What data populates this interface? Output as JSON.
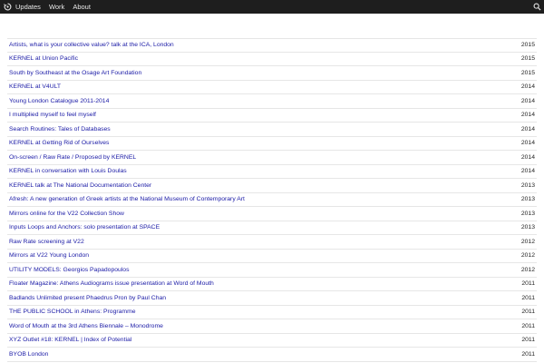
{
  "nav": {
    "logo_icon": "circular-arrows-icon",
    "items": [
      "Updates",
      "Work",
      "About"
    ],
    "search_icon": "search-icon"
  },
  "entries": [
    {
      "title": "Artists, what is your collective value? talk at the ICA, London",
      "year": "2015"
    },
    {
      "title": "KERNEL at Union Pacific",
      "year": "2015"
    },
    {
      "title": "South by Southeast at the Osage Art Foundation",
      "year": "2015"
    },
    {
      "title": "KERNEL at V4ULT",
      "year": "2014"
    },
    {
      "title": "Young London Catalogue 2011-2014",
      "year": "2014"
    },
    {
      "title": "I multiplied myself to feel myself",
      "year": "2014"
    },
    {
      "title": "Search Routines: Tales of Databases",
      "year": "2014"
    },
    {
      "title": "KERNEL at Getting Rid of Ourselves",
      "year": "2014"
    },
    {
      "title": "On-screen / Raw Rate / Proposed by KERNEL",
      "year": "2014"
    },
    {
      "title": "KERNEL in conversation with Louis Doulas",
      "year": "2014"
    },
    {
      "title": "KERNEL talk at The National Documentation Center",
      "year": "2013"
    },
    {
      "title": "Afresh: A new generation of Greek artists at the National Museum of Contemporary Art",
      "year": "2013"
    },
    {
      "title": "Mirrors online for the V22 Collection Show",
      "year": "2013"
    },
    {
      "title": "Inputs Loops and Anchors: solo presentation at SPACE",
      "year": "2013"
    },
    {
      "title": "Raw Rate screening at V22",
      "year": "2012"
    },
    {
      "title": "Mirrors at V22 Young London",
      "year": "2012"
    },
    {
      "title": "UTILITY MODELS: Georgios Papadopoulos",
      "year": "2012"
    },
    {
      "title": "Floater Magazine: Athens Audiograms issue presentation at Word of Mouth",
      "year": "2011"
    },
    {
      "title": "Badlands Unlimited present Phaedrus Pron by Paul Chan",
      "year": "2011"
    },
    {
      "title": "THE PUBLIC SCHOOL in Athens: Programme",
      "year": "2011"
    },
    {
      "title": "Word of Mouth at the 3rd Athens Biennale – Monodrome",
      "year": "2011"
    },
    {
      "title": "XYZ Outlet #18: KERNEL | Index of Potential",
      "year": "2011"
    },
    {
      "title": "BYOB London",
      "year": "2011"
    }
  ]
}
